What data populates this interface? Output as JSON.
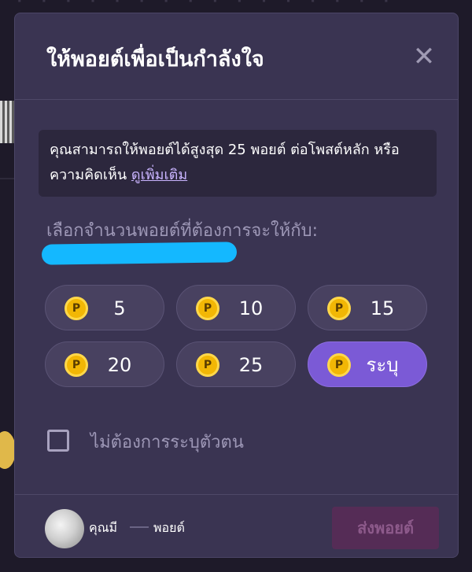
{
  "modal": {
    "title": "ให้พอยต์เพื่อเป็นกำลังใจ",
    "close_icon": "close-icon",
    "info": {
      "text": "คุณสามารถให้พอยต์ได้สูงสุด 25 พอยต์ ต่อโพสต์หลัก หรือ ความคิดเห็น",
      "link": "ดูเพิ่มเติม"
    },
    "select_label": "เลือกจำนวนพอยต์ที่ต้องการจะให้กับ:",
    "amounts": [
      {
        "label": "5",
        "selected": false
      },
      {
        "label": "10",
        "selected": false
      },
      {
        "label": "15",
        "selected": false
      },
      {
        "label": "20",
        "selected": false
      },
      {
        "label": "25",
        "selected": false
      },
      {
        "label": "ระบุ",
        "selected": true
      }
    ],
    "coin_symbol": "P",
    "anonymous": {
      "label": "ไม่ต้องการระบุตัวตน",
      "checked": false
    },
    "footer": {
      "you_have": "คุณมี",
      "points_unit": "พอยต์",
      "send_label": "ส่งพอยต์"
    }
  },
  "colors": {
    "modal_bg": "#3a3452",
    "accent": "#7b5ad6",
    "coin": "#f2b705",
    "send_disabled": "#552c56",
    "link": "#c9b4ff"
  }
}
